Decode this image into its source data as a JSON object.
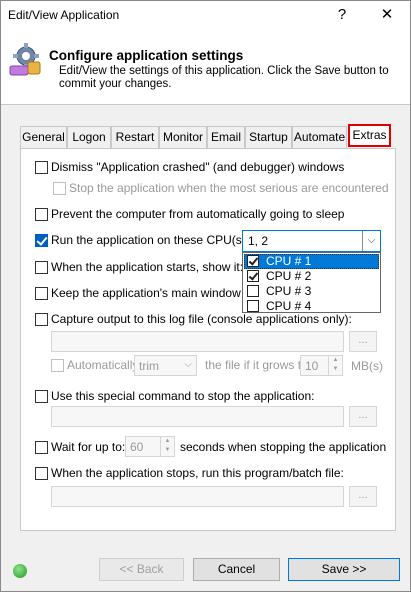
{
  "window": {
    "title": "Edit/View Application",
    "help_glyph": "?",
    "close_glyph": "✕"
  },
  "header": {
    "title": "Configure application settings",
    "subtitle": "Edit/View the settings of this application. Click the Save button to commit your changes."
  },
  "tabs": [
    "General",
    "Logon",
    "Restart",
    "Monitor",
    "Email",
    "Startup",
    "Automate",
    "Extras"
  ],
  "active_tab": "Extras",
  "options": {
    "dismiss_crash": "Dismiss \"Application crashed\" (and debugger) windows",
    "stop_on_serious": "Stop the application when the most serious are encountered",
    "prevent_sleep": "Prevent the computer from automatically going to sleep",
    "cpu_affinity": "Run the application on these CPU(s):",
    "show_on_start": "When the application starts, show it:",
    "keep_main_window": "Keep the application's main window on to",
    "capture_output": "Capture output to this log file (console applications only):",
    "auto_trim_label": "Automatically",
    "trim_mode": "trim",
    "trim_suffix": "the file if it grows to",
    "trim_size": "10",
    "trim_unit": "MB(s)",
    "stop_command": "Use this special command to stop the application:",
    "wait_prefix": "Wait for up to:",
    "wait_seconds": "60",
    "wait_suffix": "seconds when stopping the application",
    "run_on_stop": "When the application stops, run this program/batch file:",
    "browse_glyph": "..."
  },
  "cpu": {
    "selected_text": "1, 2",
    "dropdown_glyph": "⌵",
    "items": [
      {
        "label": "CPU # 1",
        "checked": true
      },
      {
        "label": "CPU # 2",
        "checked": true
      },
      {
        "label": "CPU # 3",
        "checked": false
      },
      {
        "label": "CPU # 4",
        "checked": false
      }
    ]
  },
  "buttons": {
    "back": "<< Back",
    "cancel": "Cancel",
    "save": "Save >>"
  },
  "icons": {
    "settings": "gear-icon",
    "status": "status-ok-icon",
    "accent": "#0078d7",
    "highlight": "#e00000"
  }
}
